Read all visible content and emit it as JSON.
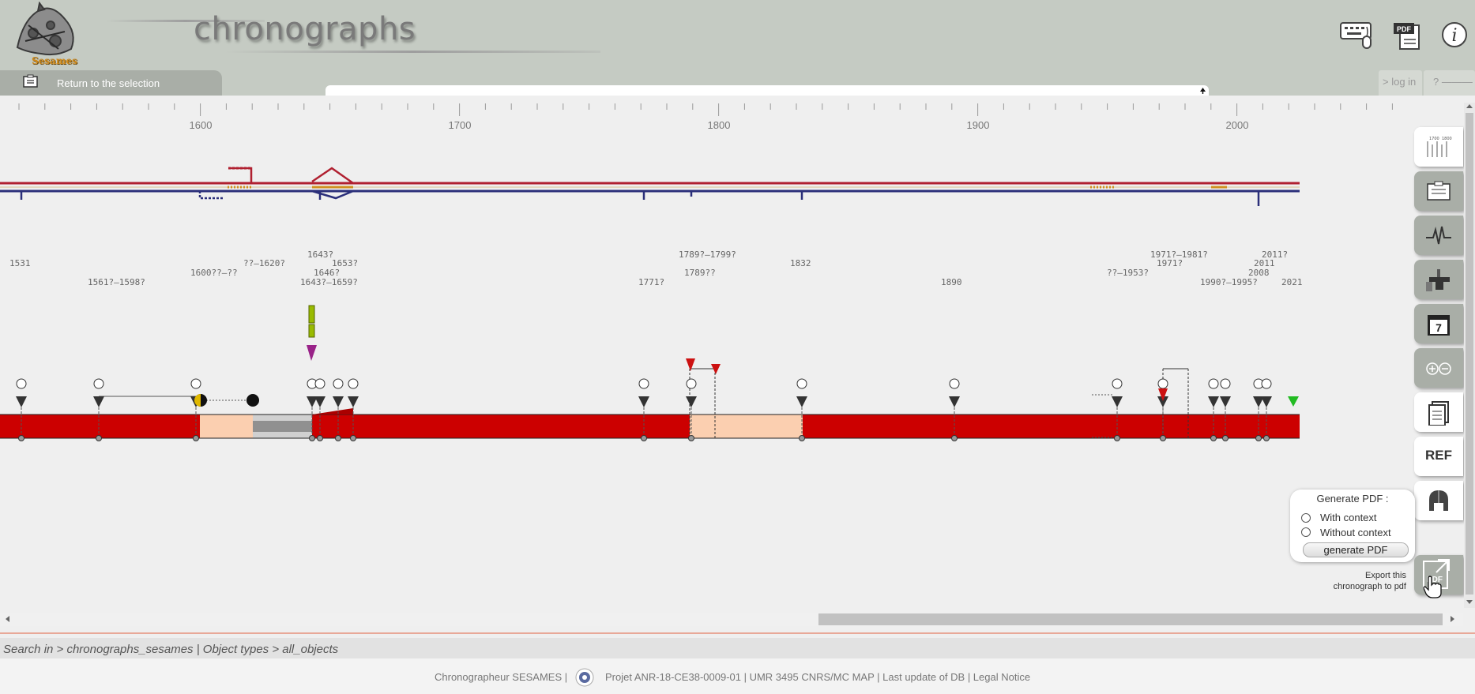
{
  "app": {
    "title": "chronographs",
    "logo_text": "Sesames"
  },
  "nav": {
    "return_label": "Return to the selection",
    "login_label": "> log in",
    "help_label": "? ———"
  },
  "header_icons": [
    "keyboard-mouse-icon",
    "pdf-document-icon",
    "info-icon"
  ],
  "timeline": {
    "axis_labels": [
      "1600",
      "1700",
      "1800",
      "1900",
      "2000"
    ],
    "event_labels": [
      "1531",
      "1561?–1598?",
      "1600??–??",
      "??–1620?",
      "1643?",
      "1653?",
      "1646?",
      "1643?–1659?",
      "1771?",
      "1789?–1799?",
      "1789??",
      "1832",
      "1890",
      "??–1953?",
      "1971?–1981?",
      "1971?",
      "1990?–1995?",
      "2011?",
      "2011",
      "2008",
      "2021"
    ]
  },
  "side_panel": {
    "buttons": [
      "timeline-scale-icon",
      "notes-icon",
      "signal-icon",
      "anvil-icon",
      "calendar-icon",
      "zoom-icon",
      "document-icon",
      "ref-button",
      "helmet-icon"
    ],
    "calendar_day": "7",
    "ref_label": "REF"
  },
  "pdf_popup": {
    "title": "Generate PDF :",
    "option_with": "With context",
    "option_without": "Without context",
    "generate_label": "generate PDF",
    "tooltip_line1": "Export this",
    "tooltip_line2": "chronograph to pdf",
    "export_icon_text": "PDF"
  },
  "status": {
    "breadcrumb": "Search in > chronographs_sesames | Object types > all_objects"
  },
  "footer": {
    "left": "Chronographeur SESAMES |",
    "right": "Projet ANR-18-CE38-0009-01 | UMR 3495 CNRS/MC MAP | Last update of DB | Legal Notice"
  },
  "colors": {
    "header_bg": "#c5cbc3",
    "band_red": "#cc0000",
    "band_peach": "#fbcfb0",
    "line_red": "#b02030",
    "line_blue": "#2b2f7a",
    "accent_green": "#99bb00",
    "accent_purple": "#992288"
  }
}
